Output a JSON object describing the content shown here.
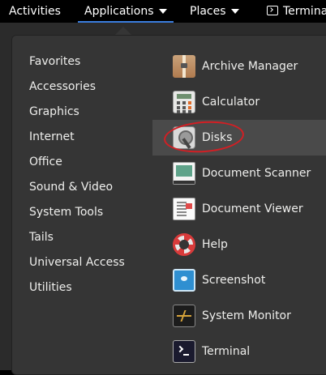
{
  "topbar": {
    "activities": "Activities",
    "applications": "Applications",
    "places": "Places",
    "terminal": "Terminal"
  },
  "categories": [
    "Favorites",
    "Accessories",
    "Graphics",
    "Internet",
    "Office",
    "Sound & Video",
    "System Tools",
    "Tails",
    "Universal Access",
    "Utilities"
  ],
  "apps": [
    {
      "label": "Archive Manager",
      "icon": "archive-icon"
    },
    {
      "label": "Calculator",
      "icon": "calculator-icon"
    },
    {
      "label": "Disks",
      "icon": "disks-icon",
      "state": "hover"
    },
    {
      "label": "Document Scanner",
      "icon": "scanner-icon"
    },
    {
      "label": "Document Viewer",
      "icon": "document-viewer-icon"
    },
    {
      "label": "Help",
      "icon": "lifebuoy-icon"
    },
    {
      "label": "Screenshot",
      "icon": "screenshot-icon"
    },
    {
      "label": "System Monitor",
      "icon": "system-monitor-icon"
    },
    {
      "label": "Terminal",
      "icon": "terminal-icon"
    }
  ],
  "colors": {
    "accent": "#3b7ddd",
    "annotation": "#d21f24"
  }
}
